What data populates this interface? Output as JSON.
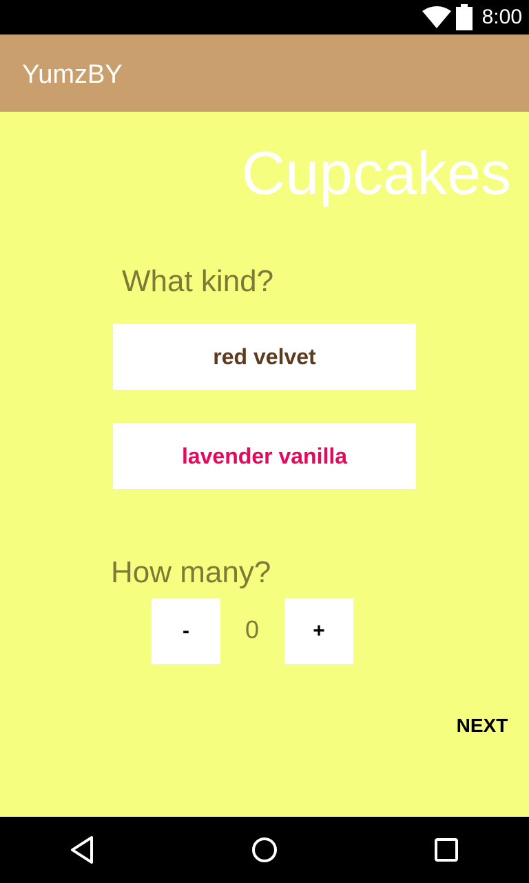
{
  "status_bar": {
    "time": "8:00",
    "icons": [
      "wifi-icon",
      "battery-icon"
    ]
  },
  "app_bar": {
    "title": "YumzBY",
    "color": "#c9a06d"
  },
  "page": {
    "title": "Cupcakes",
    "background": "#f5fe7e"
  },
  "kind": {
    "label": "What kind?",
    "options": [
      {
        "label": "red velvet",
        "color": "#5e3b1e"
      },
      {
        "label": "lavender vanilla",
        "color": "#e5085c"
      }
    ]
  },
  "quantity": {
    "label": "How many?",
    "decrement_label": "-",
    "value": "0",
    "increment_label": "+"
  },
  "actions": {
    "next_label": "NEXT"
  },
  "nav_bar": {
    "icons": [
      "back-icon",
      "home-icon",
      "recents-icon"
    ]
  }
}
